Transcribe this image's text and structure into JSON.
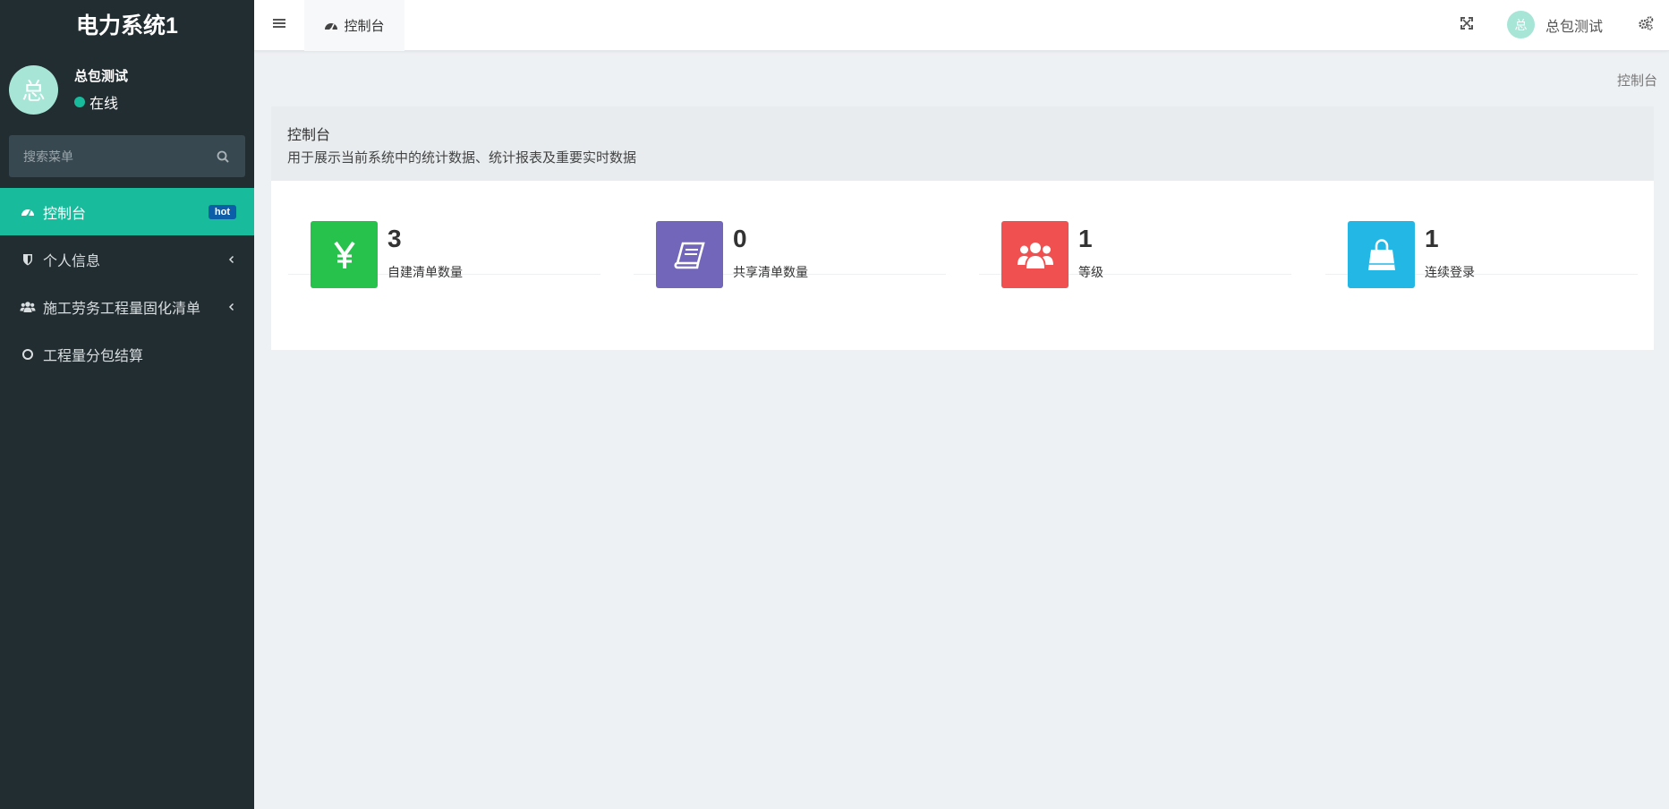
{
  "app": {
    "title": "电力系统1"
  },
  "user": {
    "name": "总包测试",
    "status": "在线",
    "avatar_char": "总"
  },
  "search": {
    "placeholder": "搜索菜单"
  },
  "menu": [
    {
      "label": "控制台",
      "icon": "dashboard-icon",
      "badge": "hot",
      "active": true
    },
    {
      "label": "个人信息",
      "icon": "shield-icon",
      "chevron": true
    },
    {
      "label": "施工劳务工程量固化清单",
      "icon": "users-icon",
      "chevron": true
    },
    {
      "label": "工程量分包结算",
      "icon": "circle-o-icon"
    }
  ],
  "header": {
    "tab_label": "控制台",
    "user_name": "总包测试",
    "avatar_char": "总"
  },
  "breadcrumb": "控制台",
  "panel": {
    "title": "控制台",
    "subtitle": "用于展示当前系统中的统计数据、统计报表及重要实时数据"
  },
  "stats": [
    {
      "value": "3",
      "label": "自建清单数量",
      "color": "#27c24c",
      "icon": "yen-icon"
    },
    {
      "value": "0",
      "label": "共享清单数量",
      "color": "#7266ba",
      "icon": "book-icon"
    },
    {
      "value": "1",
      "label": "等级",
      "color": "#f05050",
      "icon": "users-icon"
    },
    {
      "value": "1",
      "label": "连续登录",
      "color": "#23b7e5",
      "icon": "shopping-bag-icon"
    }
  ]
}
